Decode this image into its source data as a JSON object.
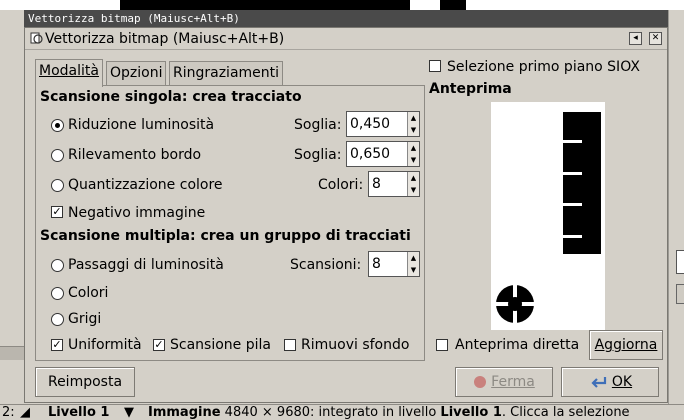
{
  "window": {
    "outer_title": "Vettorizza bitmap (Maiusc+Alt+B)",
    "title": "Vettorizza bitmap (Maiusc+Alt+B)"
  },
  "tabs": [
    {
      "label": "Modalità",
      "active": true
    },
    {
      "label": "Opzioni",
      "active": false
    },
    {
      "label": "Ringraziamenti",
      "active": false
    }
  ],
  "single_scan": {
    "heading": "Scansione singola: crea tracciato",
    "options": [
      {
        "label": "Riduzione luminosità",
        "selected": true,
        "field_label": "Soglia:",
        "value": "0,450"
      },
      {
        "label": "Rilevamento bordo",
        "selected": false,
        "field_label": "Soglia:",
        "value": "0,650"
      },
      {
        "label": "Quantizzazione colore",
        "selected": false,
        "field_label": "Colori:",
        "value": "8"
      }
    ],
    "invert": {
      "label": "Negativo immagine",
      "checked": true
    }
  },
  "multi_scan": {
    "heading": "Scansione multipla: crea un gruppo di tracciati",
    "options": [
      {
        "label": "Passaggi di luminosità",
        "selected": false,
        "field_label": "Scansioni:",
        "value": "8"
      },
      {
        "label": "Colori",
        "selected": false
      },
      {
        "label": "Grigi",
        "selected": false
      }
    ],
    "checks": [
      {
        "label": "Uniformità",
        "checked": true
      },
      {
        "label": "Scansione pila",
        "checked": true
      },
      {
        "label": "Rimuovi sfondo",
        "checked": false
      }
    ]
  },
  "siox": {
    "label": "Selezione primo piano SIOX",
    "checked": false
  },
  "preview": {
    "heading": "Anteprima",
    "live": {
      "label": "Anteprima diretta",
      "checked": false
    },
    "update_label": "Aggiorna"
  },
  "buttons": {
    "reset": "Reimposta",
    "stop": "Ferma",
    "ok": "OK"
  },
  "status_bar": {
    "left": "2:",
    "layer": "Livello 1",
    "info_bold": "Immagine",
    "info_rest": " 4840 × 9680: integrato in livello ",
    "info_layer": "Livello 1",
    "info_end": ". Clicca la selezione"
  },
  "colors": {
    "title_bar": "#4a4a4a",
    "dialog_bg": "#d4d0c8",
    "preview_shape": "#000000",
    "stop_icon": "#c04040",
    "ok_icon": "#3f6fb8"
  }
}
